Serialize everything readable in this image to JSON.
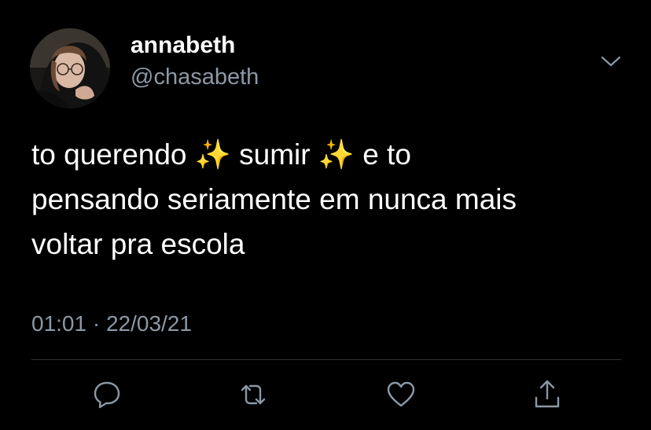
{
  "profile": {
    "display_name": "annabeth",
    "handle": "@chasabeth",
    "avatar_icon": "profile-photo"
  },
  "tweet": {
    "text": "to querendo ✨ sumir ✨ e to\npensando seriamente em nunca mais\nvoltar pra escola",
    "timestamp": "01:01 · 22/03/21"
  },
  "actions": {
    "reply_icon": "speech-bubble-icon",
    "retweet_icon": "retweet-arrows-icon",
    "like_icon": "heart-icon",
    "share_icon": "share-upload-icon",
    "more_icon": "chevron-down-icon"
  },
  "colors": {
    "background": "#000000",
    "primary_text": "#ffffff",
    "secondary_text": "#8b98a5",
    "divider": "#2f3336"
  }
}
